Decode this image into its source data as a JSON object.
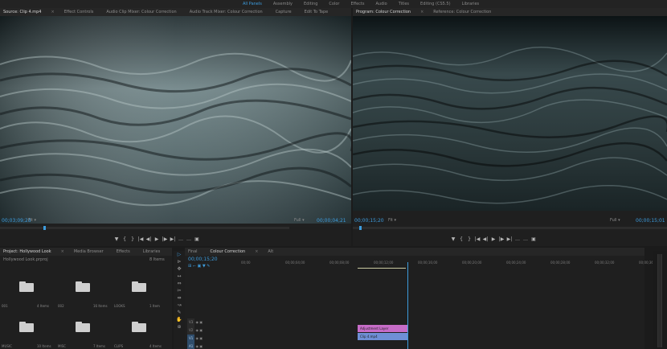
{
  "menu": {
    "workspaces": [
      "All Panels",
      "Assembly",
      "Editing",
      "Color",
      "Effects",
      "Audio",
      "Titles",
      "Editing (CS5.5)",
      "Libraries"
    ],
    "active_index": 0
  },
  "source_monitor": {
    "tabs": [
      {
        "label": "Source: Clip 4.mp4",
        "active": true
      },
      {
        "label": "Effect Controls",
        "active": false
      },
      {
        "label": "Audio Clip Mixer: Colour Correction",
        "active": false
      },
      {
        "label": "Audio Track Mixer: Colour Correction",
        "active": false
      },
      {
        "label": "Capture",
        "active": false
      },
      {
        "label": "Edit To Tape",
        "active": false
      }
    ],
    "timecode": "00;03;09;28",
    "zoom": "Fit",
    "resolution": "Full",
    "duration": "00;00;04;21",
    "playhead_fraction": 0.15
  },
  "program_monitor": {
    "tabs": [
      {
        "label": "Program: Colour Correction",
        "active": true
      },
      {
        "label": "Reference: Colour Correction",
        "active": false
      }
    ],
    "timecode": "00;00;15;20",
    "zoom": "Fit",
    "resolution": "Full",
    "duration": "00;00;15;01",
    "playhead_fraction": 0.02
  },
  "transport": {
    "buttons": [
      "▼",
      "{",
      "}",
      "|◀",
      "◀|",
      "▶",
      "|▶",
      "▶|",
      "…",
      "…",
      "▣"
    ]
  },
  "project": {
    "tabs": [
      {
        "label": "Project: Hollywood Look",
        "active": true
      },
      {
        "label": "Media Browser",
        "active": false
      },
      {
        "label": "Effects",
        "active": false
      },
      {
        "label": "Libraries",
        "active": false
      }
    ],
    "file": "Hollywood Look.prproj",
    "item_count": "8 Items",
    "bins": [
      {
        "name": "001",
        "count": "4 Items"
      },
      {
        "name": "002",
        "count": "16 Items"
      },
      {
        "name": "LOOKS",
        "count": "1 Item"
      },
      {
        "name": "MUSIC",
        "count": "10 Items"
      },
      {
        "name": "MISC",
        "count": "7 Items"
      },
      {
        "name": "CLIPS",
        "count": "4 Items"
      }
    ]
  },
  "timeline": {
    "tabs": [
      {
        "label": "Final",
        "active": false
      },
      {
        "label": "Colour Correction",
        "active": true
      },
      {
        "label": "Alt",
        "active": false
      }
    ],
    "timecode": "00;00;15;20",
    "ruler": [
      "00;00",
      "00;00;04;00",
      "00;00;08;00",
      "00;00;12;00",
      "00;00;16;00",
      "00;00;20;00",
      "00;00;24;00",
      "00;00;28;00",
      "00;00;32;00",
      "00;00;36;00"
    ],
    "tracks": [
      {
        "name": "V3"
      },
      {
        "name": "V2"
      },
      {
        "name": "V1"
      },
      {
        "name": "A1"
      }
    ],
    "clips": [
      {
        "label": "Adjustment Layer",
        "color": "#c66cc7"
      },
      {
        "label": "Clip 4.mp4",
        "color": "#6f8fd6"
      }
    ]
  },
  "colors": {
    "accent": "#3d9cdd",
    "panel": "#1f1f1f"
  }
}
